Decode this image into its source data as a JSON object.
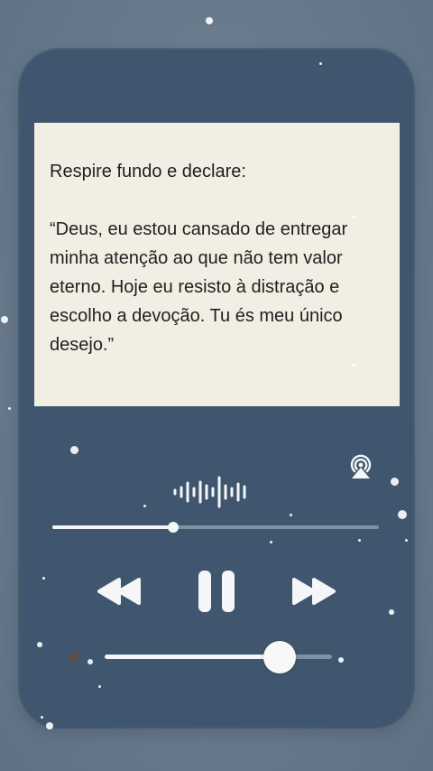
{
  "quote": {
    "intro": "Respire fundo e declare:",
    "text": "“Deus, eu estou cansado de entregar minha atenção ao que não tem valor eterno. Hoje eu resisto à distração e escolho a devoção. Tu és meu único desejo.”"
  },
  "player": {
    "progress_fraction": 0.37,
    "volume_fraction": 0.77,
    "icons": {
      "airplay": "airplay-icon",
      "waveform": "waveform-icon",
      "rewind": "rewind-icon",
      "pause": "pause-icon",
      "forward": "fast-forward-icon",
      "volume": "speaker-icon"
    }
  },
  "colors": {
    "background": "#6b7d8f",
    "phone": "#40566f",
    "card": "#f1efe4",
    "text": "#1f1f1f",
    "controls": "#f4f6f8",
    "track": "#7f91a5"
  }
}
